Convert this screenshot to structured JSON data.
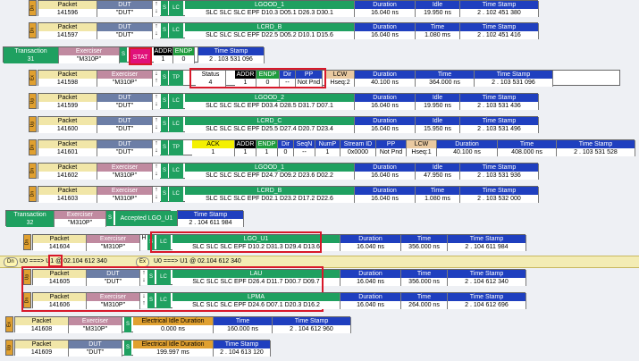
{
  "rows": [
    {
      "id": "r1",
      "tag": "Dn",
      "pkt": "141596",
      "src": "\"DUT\"",
      "lc_title": "LGOOD_1",
      "lc_body": "SLC SLC SLC EPF D10.3 D05.1 D26.3 D30.1",
      "dur": "16.040 ns",
      "idle_h": "Idle",
      "idle": "19.950 ns",
      "ts": "2 . 102 451 380"
    },
    {
      "id": "r2",
      "tag": "Dn",
      "pkt": "141597",
      "src": "\"DUT\"",
      "lc_title": "LCRD_B",
      "lc_body": "SLC SLC SLC EPF D22.5 D05.2 D10.1 D15.6",
      "dur": "16.040 ns",
      "idle_h": "Time",
      "idle": "1.080 ms",
      "ts": "2 . 102 451 416"
    },
    {
      "id": "r4",
      "tag": "Up",
      "pkt": "141599",
      "src": "\"DUT\"",
      "lc_title": "LGOOD_2",
      "lc_body": "SLC SLC SLC EPF D03.4 D28.5 D31.7 D07.1",
      "dur": "16.040 ns",
      "idle_h": "Idle",
      "idle": "19.950 ns",
      "ts": "2 . 103 531 436"
    },
    {
      "id": "r5",
      "tag": "Up",
      "pkt": "141600",
      "src": "\"DUT\"",
      "lc_title": "LCRD_C",
      "lc_body": "SLC SLC SLC EPF D25.5 D27.4 D20.7 D23.4",
      "dur": "16.040 ns",
      "idle_h": "Idle",
      "idle": "15.950 ns",
      "ts": "2 . 103 531 496"
    },
    {
      "id": "r7",
      "tag": "Dn",
      "pkt": "141602",
      "src": "\"M310P\"",
      "lc_title": "LGOOD_1",
      "lc_body": "SLC SLC SLC EPF D24.7 D09.2 D23.6 D02.2",
      "dur": "16.040 ns",
      "idle_h": "Idle",
      "idle": "47.950 ns",
      "ts": "2 . 103 531 936"
    },
    {
      "id": "r8",
      "tag": "Dn",
      "pkt": "141603",
      "src": "\"M310P\"",
      "lc_title": "LCRD_B",
      "lc_body": "SLC SLC SLC EPF D02.1 D23.2 D17.2 D22.6",
      "dur": "16.040 ns",
      "idle_h": "Time",
      "idle": "1.080 ms",
      "ts": "2 . 103 532 000"
    }
  ],
  "trans31": {
    "label": "Transaction",
    "num": "31",
    "exec_h": "Exerciser",
    "exec": "\"M310P\"",
    "stat": "STAT",
    "addr_h": "ADDR",
    "addr": "1",
    "endp_h": "ENDP",
    "endp": "0",
    "ts_h": "Time Stamp",
    "ts": "2 . 103 531 096"
  },
  "row3": {
    "pkt": "141598",
    "exec": "\"M310P\"",
    "tp": "TP",
    "status_h": "Status",
    "status": "4",
    "addr_h": "ADDR",
    "addr": "1",
    "endp_h": "ENDP",
    "endp": "0",
    "dir_h": "Dir",
    "dir": "--",
    "pp_h": "PP",
    "pp": "Not Pnd",
    "lcw_h": "LCW",
    "lcw": "Hseq:2",
    "dur": "40.100 ns",
    "time_h": "Time",
    "time": "364.000 ns",
    "ts": "2 . 103 531 096"
  },
  "row6": {
    "pkt": "141601",
    "src": "\"DUT\"",
    "tp": "TP",
    "ack": "ACK",
    "addr": "1",
    "endp": "1",
    "dir": "0",
    "seqn": "--",
    "nump": "1",
    "streamid": "0",
    "pp": "0x0000",
    "pp2": "Not Pnd",
    "lcw": "Hseq:1",
    "dur": "40.100 ns",
    "time": "408.000 ns",
    "ts": "2 . 103 531 528",
    "h": {
      "addr": "ADDR",
      "endp": "ENDP",
      "dir": "Dir",
      "seqn": "SeqN",
      "nump": "NumP",
      "stream": "Stream ID",
      "pp": "PP",
      "lcw": "LCW",
      "dur": "Duration",
      "time": "Time",
      "ts": "Time Stamp"
    }
  },
  "trans32": {
    "label": "Transaction",
    "num": "32",
    "exec": "\"M310P\"",
    "accepted": "Accepted LGO_U1",
    "ts": "2 . 104 611 984"
  },
  "row_u1": {
    "pkt": "141604",
    "exec": "\"M310P\"",
    "title": "LGO_U1",
    "body": "SLC SLC SLC EPF D10.2 D31.3 D29.4 D13.6",
    "dur": "16.040 ns",
    "time": "356.000 ns",
    "ts": "2 . 104 611 984"
  },
  "banner": {
    "left": "U0 ===> U1 @ 02.104 612 340",
    "right": "U0 ===> U1 @ 02.104 612 340",
    "dn": "Dn",
    "ex": "Ex"
  },
  "row_lau": {
    "pkt": "141605",
    "src": "\"DUT\"",
    "title": "LAU",
    "body": "SLC SLC SLC EPF D26.4 D11.7 D00.7 D09.7",
    "dur": "16.040 ns",
    "time": "356.000 ns",
    "ts": "2 . 104 612 340"
  },
  "row_lpma": {
    "pkt": "141606",
    "exec": "\"M310P\"",
    "title": "LPMA",
    "body": "SLC SLC SLC EPF D24.6 D07.1 D20.3 D16.2",
    "dur": "16.040 ns",
    "time": "264.000 ns",
    "ts": "2 . 104 612 696"
  },
  "row_ei1": {
    "pkt": "141608",
    "exec": "\"M310P\"",
    "ei_h": "Electrical Idle Duration",
    "ei": "0.000 ns",
    "time": "160.000 ns",
    "ts": "2 . 104 612 960"
  },
  "row_ei2": {
    "pkt": "141609",
    "src": "\"DUT\"",
    "ei_h": "Electrical Idle Duration",
    "ei": "199.997 ms",
    "ts": "2 . 104 613 120"
  },
  "labels": {
    "packet": "Packet",
    "dut": "DUT",
    "exerciser": "Exerciser",
    "duration": "Duration",
    "time": "Time",
    "timestamp": "Time Stamp",
    "s": "S",
    "lc": "LC",
    "h": "H",
    "c": "C"
  }
}
